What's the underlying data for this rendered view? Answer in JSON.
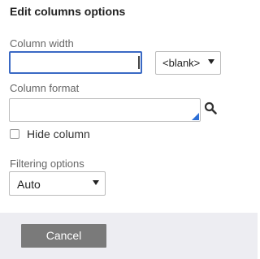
{
  "dialog": {
    "title": "Edit columns options"
  },
  "column_width": {
    "label": "Column width",
    "value": "",
    "unit_select": {
      "selected": "<blank>"
    }
  },
  "column_format": {
    "label": "Column format",
    "value": ""
  },
  "hide_column": {
    "label": "Hide column",
    "checked": false
  },
  "filtering": {
    "label": "Filtering options",
    "selected": "Auto"
  },
  "footer": {
    "cancel_label": "Cancel"
  },
  "icons": {
    "search": "search-icon",
    "dropdown": "chevron-down-icon"
  },
  "colors": {
    "focus_border": "#3a69c4",
    "accent_corner": "#2d6fd6",
    "cancel_button_bg": "#7a7a7a",
    "footer_bg": "#ededf2"
  }
}
